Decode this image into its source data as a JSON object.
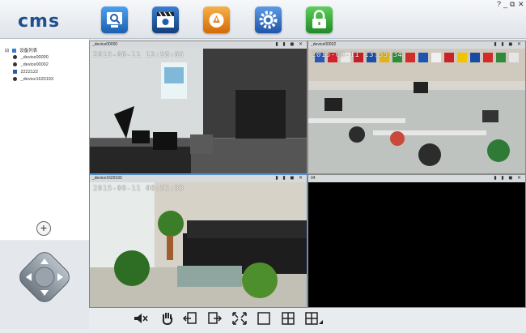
{
  "app": {
    "logo": "cms",
    "window_controls": {
      "help": "?",
      "minimize": "_",
      "restore": "⧉",
      "close": "✕"
    }
  },
  "toolbar": {
    "tools": [
      {
        "name": "preview",
        "icon": "monitor-search-icon",
        "color": "#2f7fd6"
      },
      {
        "name": "playback",
        "icon": "film-clapper-icon",
        "color": "#1f5faa"
      },
      {
        "name": "alarm",
        "icon": "alarm-icon",
        "color": "#e98b1a"
      },
      {
        "name": "settings",
        "icon": "gear-icon",
        "color": "#2f6fc6"
      },
      {
        "name": "lock",
        "icon": "lock-icon",
        "color": "#2e9a35"
      }
    ]
  },
  "tree": {
    "root": "设备列表",
    "items": [
      "_device00000",
      "_device00002",
      "2222122",
      "_device1620193"
    ]
  },
  "panes": [
    {
      "title": "_device00000",
      "osd": "2015-08-11 13:58:05"
    },
    {
      "title": "_device00002",
      "osd": "2015-08-11 13:55:34"
    },
    {
      "title": "_device1620193",
      "osd": "2015-08-11 08:51:53"
    },
    {
      "title": "04",
      "osd": ""
    }
  ],
  "add_button": "+"
}
